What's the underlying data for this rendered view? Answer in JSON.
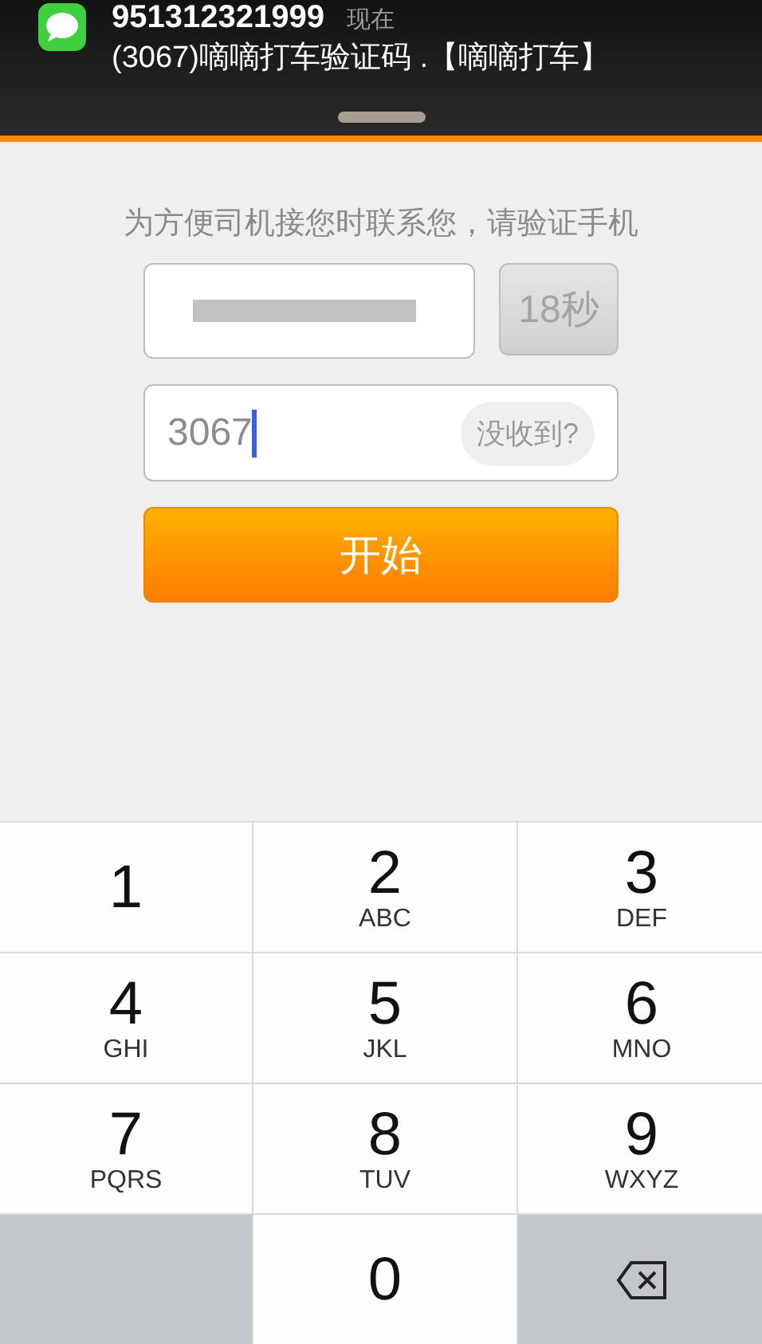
{
  "notification": {
    "sender": "951312321999",
    "time": "现在",
    "message": "(3067)嘀嘀打车验证码 .【嘀嘀打车】"
  },
  "prompt": "为方便司机接您时联系您，请验证手机",
  "countdown_button": "18秒",
  "code_field": {
    "value": "3067",
    "resend": "没收到?"
  },
  "start_button": "开始",
  "keypad": [
    {
      "kind": "digit",
      "digit": "1"
    },
    {
      "kind": "digit",
      "digit": "2",
      "letters": "ABC"
    },
    {
      "kind": "digit",
      "digit": "3",
      "letters": "DEF"
    },
    {
      "kind": "digit",
      "digit": "4",
      "letters": "GHI"
    },
    {
      "kind": "digit",
      "digit": "5",
      "letters": "JKL"
    },
    {
      "kind": "digit",
      "digit": "6",
      "letters": "MNO"
    },
    {
      "kind": "digit",
      "digit": "7",
      "letters": "PQRS"
    },
    {
      "kind": "digit",
      "digit": "8",
      "letters": "TUV"
    },
    {
      "kind": "digit",
      "digit": "9",
      "letters": "WXYZ"
    },
    {
      "kind": "blank"
    },
    {
      "kind": "digit",
      "digit": "0"
    },
    {
      "kind": "delete"
    }
  ]
}
